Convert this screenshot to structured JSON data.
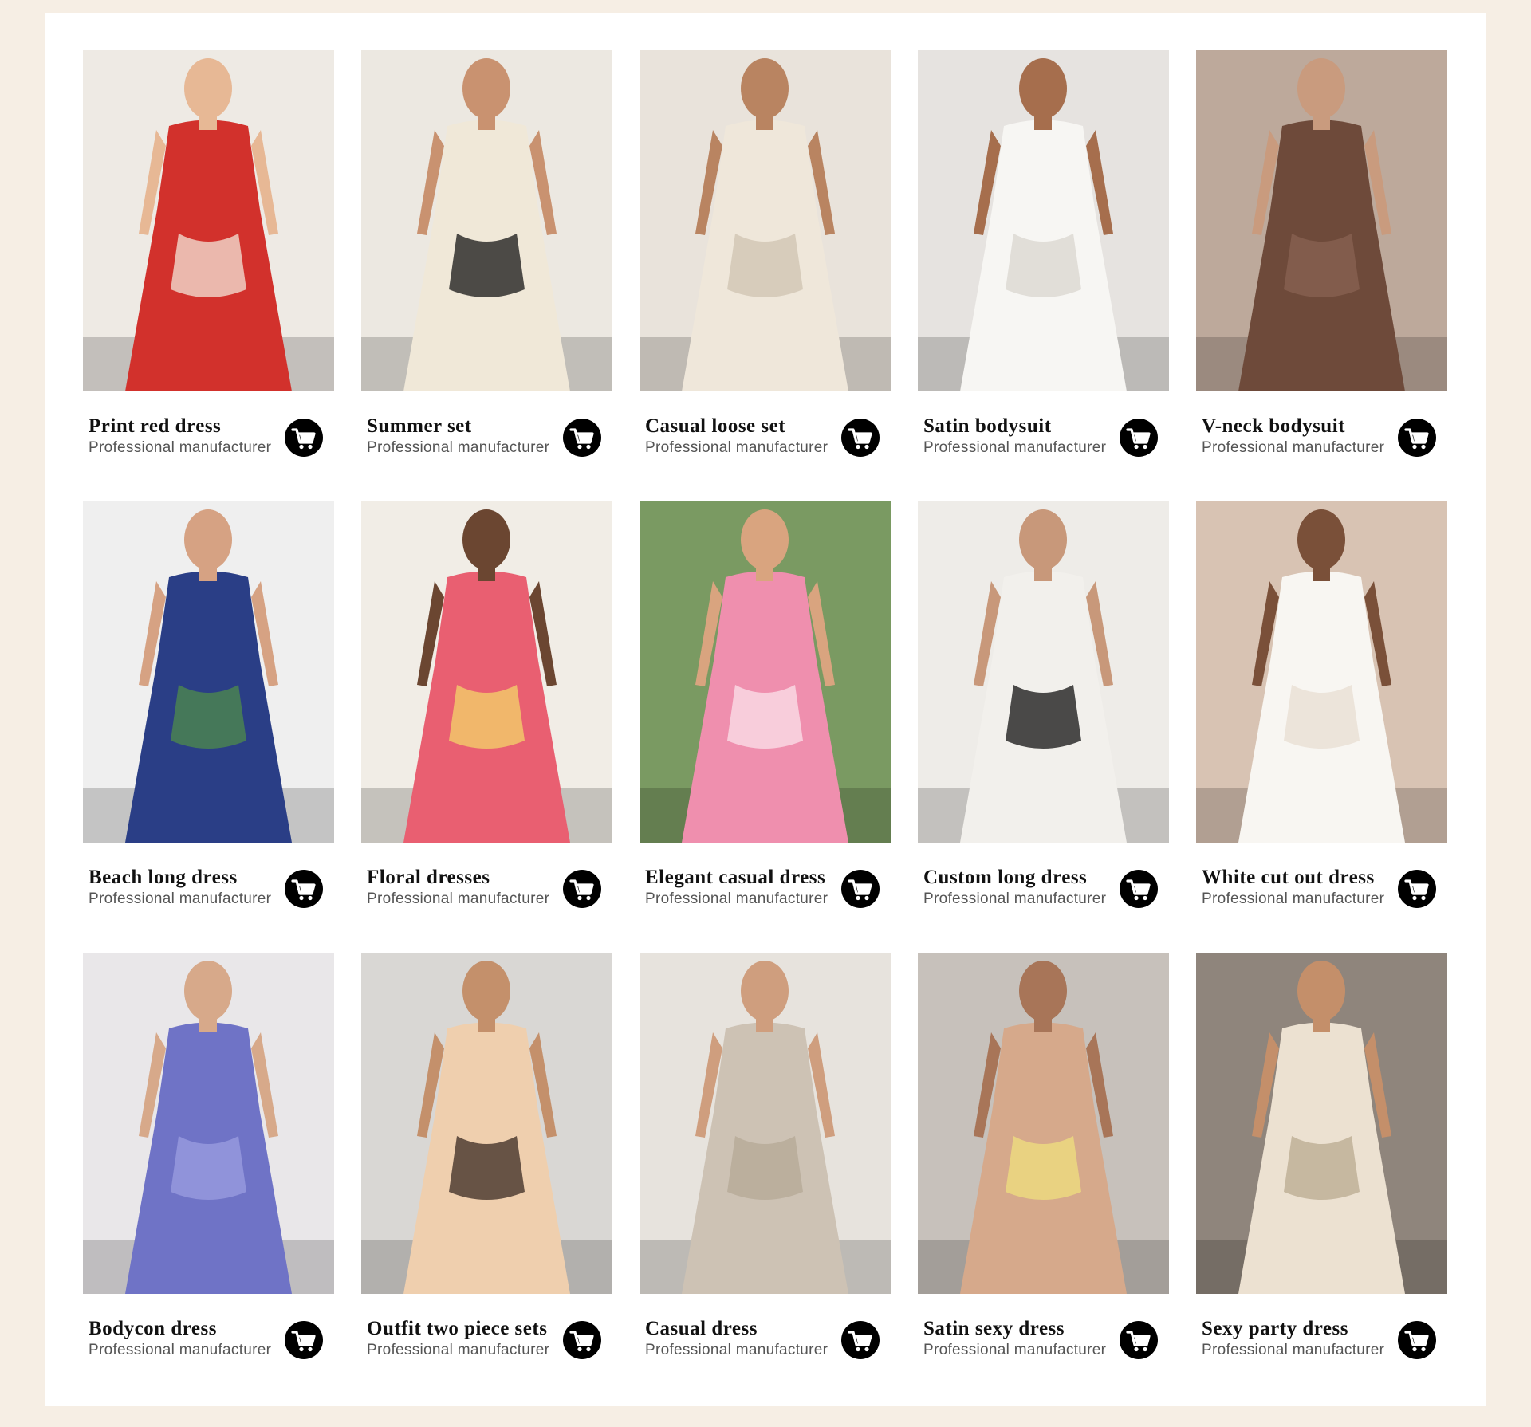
{
  "products": [
    {
      "name": "Print red dress",
      "subtitle": "Professional manufacturer",
      "image": "woman-in-red-floral-sundress-photo",
      "colors": {
        "bg": "#eeeae4",
        "garment": "#d2312c",
        "accent": "#f3e5d8",
        "skin": "#e7b895"
      }
    },
    {
      "name": "Summer set",
      "subtitle": "Professional manufacturer",
      "image": "woman-in-black-white-print-shirt-shorts-photo",
      "colors": {
        "bg": "#ece8e1",
        "garment": "#f0e8d8",
        "accent": "#161616",
        "skin": "#c99270"
      }
    },
    {
      "name": "Casual loose set",
      "subtitle": "Professional manufacturer",
      "image": "woman-in-cream-linen-jacket-trousers-photo",
      "colors": {
        "bg": "#e9e3db",
        "garment": "#efe7da",
        "accent": "#cfc3b0",
        "skin": "#b98461"
      }
    },
    {
      "name": "Satin bodysuit",
      "subtitle": "Professional manufacturer",
      "image": "woman-in-white-satin-bodysuit-photo",
      "colors": {
        "bg": "#e6e3e0",
        "garment": "#f7f6f3",
        "accent": "#d9d5cf",
        "skin": "#a66e4d"
      }
    },
    {
      "name": "V-neck bodysuit",
      "subtitle": "Professional manufacturer",
      "image": "woman-in-brown-v-neck-bodysuit-photo",
      "colors": {
        "bg": "#bda99b",
        "garment": "#6e4a3a",
        "accent": "#8a6353",
        "skin": "#c99b7e"
      }
    },
    {
      "name": "Beach long dress",
      "subtitle": "Professional manufacturer",
      "image": "woman-in-tropical-print-maxi-dress-photo",
      "colors": {
        "bg": "#efefef",
        "garment": "#2a3e86",
        "accent": "#4f8c4a",
        "skin": "#d6a283"
      }
    },
    {
      "name": "Floral dresses",
      "subtitle": "Professional manufacturer",
      "image": "woman-in-pink-yellow-print-shirt-dress-photo",
      "colors": {
        "bg": "#f1ede6",
        "garment": "#e95f71",
        "accent": "#f3d46a",
        "skin": "#6b4631"
      }
    },
    {
      "name": "Elegant casual dress",
      "subtitle": "Professional manufacturer",
      "image": "woman-in-pink-paisley-maxi-dress-photo",
      "colors": {
        "bg": "#7a9a62",
        "garment": "#ef8fae",
        "accent": "#fbe1ea",
        "skin": "#d9a47f"
      }
    },
    {
      "name": "Custom long dress",
      "subtitle": "Professional manufacturer",
      "image": "woman-in-zebra-print-long-dress-photo",
      "colors": {
        "bg": "#eeece8",
        "garment": "#f2f0ec",
        "accent": "#121212",
        "skin": "#c8987a"
      }
    },
    {
      "name": "White cut out dress",
      "subtitle": "Professional manufacturer",
      "image": "woman-in-white-cut-out-maxi-dress-photo",
      "colors": {
        "bg": "#d8c3b3",
        "garment": "#f8f6f2",
        "accent": "#e8ded2",
        "skin": "#7a5039"
      }
    },
    {
      "name": "Bodycon dress",
      "subtitle": "Professional manufacturer",
      "image": "woman-in-blue-lace-bodycon-dress-photo",
      "colors": {
        "bg": "#e9e7e9",
        "garment": "#6f73c6",
        "accent": "#9b9de0",
        "skin": "#d7a98a"
      }
    },
    {
      "name": "Outfit two piece sets",
      "subtitle": "Professional manufacturer",
      "image": "woman-in-nude-two-piece-set-photo",
      "colors": {
        "bg": "#d9d7d4",
        "garment": "#efcfae",
        "accent": "#3a2a22",
        "skin": "#c4906b"
      }
    },
    {
      "name": "Casual dress",
      "subtitle": "Professional manufacturer",
      "image": "woman-in-linen-puff-sleeve-dress-photo",
      "colors": {
        "bg": "#e7e3dd",
        "garment": "#cdc2b4",
        "accent": "#b4a896",
        "skin": "#cf9e7e"
      }
    },
    {
      "name": "Satin sexy dress",
      "subtitle": "Professional manufacturer",
      "image": "three-women-in-satin-skirts-photo",
      "colors": {
        "bg": "#c7c1bb",
        "garment": "#d6a98b",
        "accent": "#efe07e",
        "skin": "#a87558"
      }
    },
    {
      "name": "Sexy party dress",
      "subtitle": "Professional manufacturer",
      "image": "woman-in-beige-halter-maxi-dress-photo",
      "colors": {
        "bg": "#8f857c",
        "garment": "#ece1d1",
        "accent": "#b9a98f",
        "skin": "#c48f6a"
      }
    }
  ],
  "cart_icon": "shopping-cart-icon",
  "colors": {
    "page_bg": "#f6eee4",
    "panel_bg": "#ffffff",
    "title": "#111111",
    "subtitle": "#555555",
    "cart_bg": "#000000"
  }
}
